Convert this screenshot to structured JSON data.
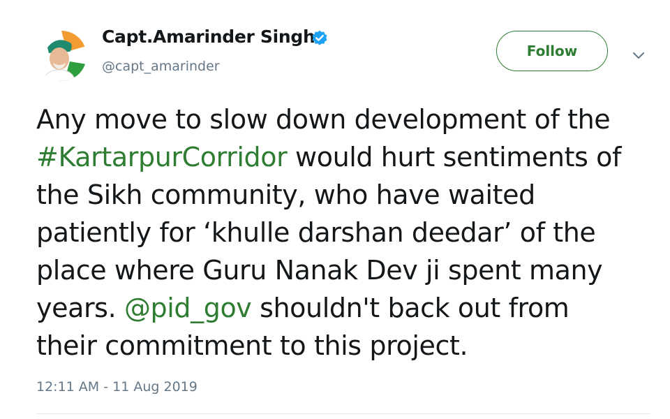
{
  "user": {
    "display_name": "Capt.Amarinder Singh",
    "handle": "@capt_amarinder",
    "verified": true,
    "verified_icon": "verified-badge-icon"
  },
  "actions": {
    "follow_label": "Follow",
    "more_icon": "chevron-down-icon"
  },
  "tweet": {
    "lines": [
      [
        {
          "text": "Any move to slow down development of the"
        }
      ],
      [
        {
          "text": "#KartarpurCorridor",
          "type": "hashtag"
        },
        {
          "text": " would hurt sentiments of"
        }
      ],
      [
        {
          "text": "the Sikh community, who have waited"
        }
      ],
      [
        {
          "text": "patiently for ‘khulle darshan deedar’ of the"
        }
      ],
      [
        {
          "text": "place where Guru Nanak Dev ji spent many"
        }
      ],
      [
        {
          "text": "years. "
        },
        {
          "text": "@pid_gov",
          "type": "mention"
        },
        {
          "text": " shouldn't back out from"
        }
      ],
      [
        {
          "text": "their commitment to this project."
        }
      ]
    ],
    "timestamp": "12:11 AM - 11 Aug 2019"
  },
  "colors": {
    "link": "#2e7d32",
    "text": "#14171a",
    "muted": "#657786",
    "verified": "#1da1f2"
  }
}
